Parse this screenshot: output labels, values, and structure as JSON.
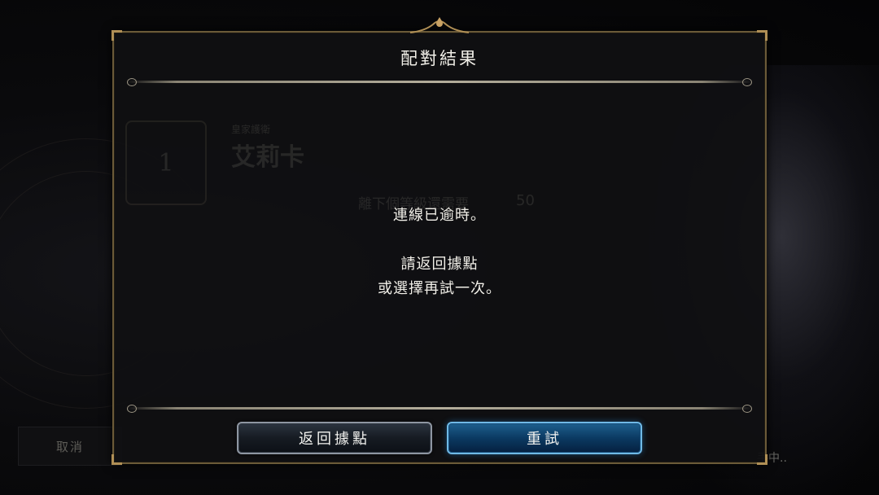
{
  "background": {
    "cancel_label": "取消",
    "matching_label": "手中.."
  },
  "dialog": {
    "title": "配對結果",
    "faded": {
      "rank": "1",
      "subtitle": "皇家護衛",
      "name": "艾莉卡",
      "row_label": "離下個等級還需要",
      "row_value": "50"
    },
    "message_line1": "連線已逾時。",
    "message_line2": "請返回據點",
    "message_line3": "或選擇再試一次。",
    "buttons": {
      "back_label": "返回據點",
      "retry_label": "重試"
    }
  },
  "colors": {
    "frame_gold": "#6b5a38",
    "retry_blue": "#6fb9e6",
    "back_steel": "#8e96a2"
  }
}
